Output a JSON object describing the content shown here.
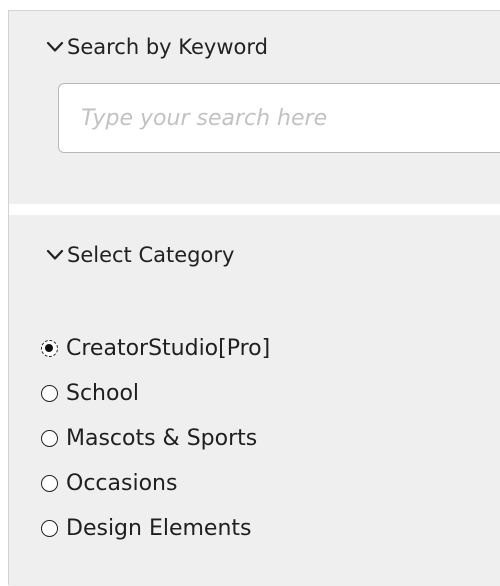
{
  "search_section": {
    "header": "Search by Keyword",
    "input_value": "",
    "input_placeholder": "Type your search here"
  },
  "category_section": {
    "header": "Select Category",
    "options": [
      {
        "label": "CreatorStudio[Pro]",
        "checked": true
      },
      {
        "label": "School",
        "checked": false
      },
      {
        "label": "Mascots & Sports",
        "checked": false
      },
      {
        "label": "Occasions",
        "checked": false
      },
      {
        "label": "Design Elements",
        "checked": false
      }
    ]
  },
  "icons": {
    "section_toggle": "chevron-down-icon"
  }
}
